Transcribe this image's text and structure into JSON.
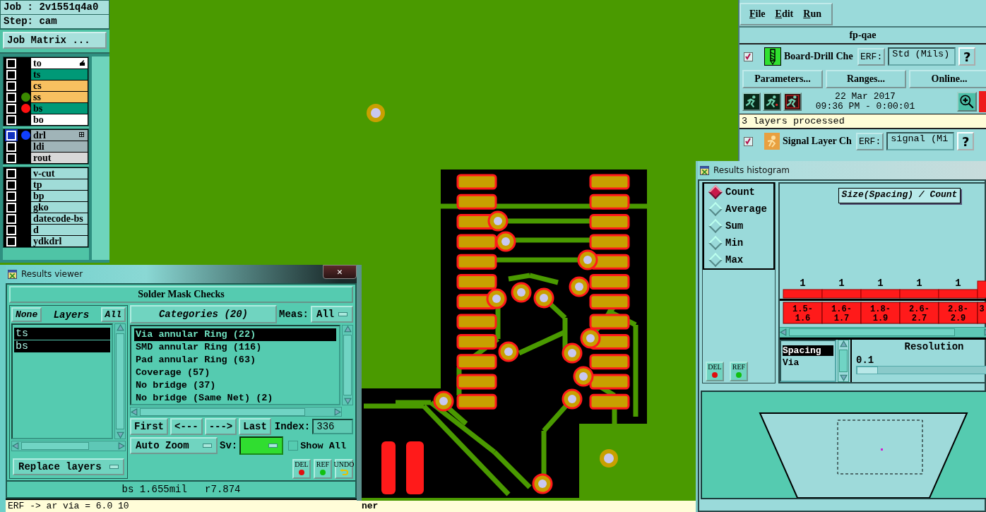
{
  "left_panel": {
    "job": "Job : 2v1551q4a0",
    "step": "Step: cam",
    "matrix_button": "Job Matrix ...",
    "layer_groups": [
      {
        "layers": [
          {
            "name": "to",
            "color": "#ffffff",
            "checked": false,
            "selected": false,
            "kind": "active"
          },
          {
            "name": "ts",
            "color": "#009977",
            "checked": false,
            "selected": false,
            "kind": "plain"
          },
          {
            "name": "cs",
            "color": "#f8c060",
            "checked": false,
            "selected": false,
            "kind": "plain"
          },
          {
            "name": "ss",
            "color": "#f8c060",
            "checked": false,
            "selected": false,
            "kind": "plain",
            "dot": {
              "color": "#3a8a00"
            }
          },
          {
            "name": "bs",
            "color": "#009977",
            "checked": false,
            "selected": false,
            "kind": "plain",
            "dot": {
              "color": "#ff1010"
            }
          },
          {
            "name": "bo",
            "color": "#ffffff",
            "checked": false,
            "selected": false,
            "kind": "plain"
          }
        ]
      },
      {
        "layers": [
          {
            "name": "drl",
            "color": "#a0b4b8",
            "checked": false,
            "selected": true,
            "kind": "expandable",
            "dot": {
              "color": "#1040ff"
            }
          },
          {
            "name": "ldi",
            "color": "#a0b4b8",
            "checked": false,
            "selected": false,
            "kind": "plain"
          },
          {
            "name": "rout",
            "color": "#d8d8d8",
            "checked": false,
            "selected": false,
            "kind": "plain"
          }
        ]
      },
      {
        "layers": [
          {
            "name": "v-cut",
            "color": "#a0dcd8",
            "checked": false,
            "selected": false,
            "kind": "plain"
          },
          {
            "name": "tp",
            "color": "#a0dcd8",
            "checked": false,
            "selected": false,
            "kind": "plain"
          },
          {
            "name": "bp",
            "color": "#a0dcd8",
            "checked": false,
            "selected": false,
            "kind": "plain"
          },
          {
            "name": "gko",
            "color": "#a0dcd8",
            "checked": false,
            "selected": false,
            "kind": "plain"
          },
          {
            "name": "datecode-bs",
            "color": "#a0dcd8",
            "checked": false,
            "selected": false,
            "kind": "plain"
          },
          {
            "name": "d",
            "color": "#a0dcd8",
            "checked": false,
            "selected": false,
            "kind": "plain"
          },
          {
            "name": "ydkdrl",
            "color": "#a0dcd8",
            "checked": false,
            "selected": false,
            "kind": "plain"
          }
        ]
      }
    ]
  },
  "results_viewer": {
    "title": "Results viewer",
    "close": "✕",
    "header": "Solder Mask Checks",
    "none_button": "None",
    "layers_label": "Layers",
    "all_button": "All",
    "layers": [
      {
        "name": "ts",
        "selected": true
      },
      {
        "name": "bs",
        "selected": true
      }
    ],
    "replace_dropdown": "Replace layers",
    "categories_button": "Categories (20)",
    "meas_label": "Meas:",
    "meas_value": "All",
    "categories": [
      {
        "label": "Via annular Ring (22)",
        "selected": true
      },
      {
        "label": "SMD annular Ring (116)",
        "selected": false
      },
      {
        "label": "Pad annular Ring (63)",
        "selected": false
      },
      {
        "label": "Coverage (57)",
        "selected": false
      },
      {
        "label": "No bridge (37)",
        "selected": false
      },
      {
        "label": "No bridge (Same Net) (2)",
        "selected": false
      }
    ],
    "nav_buttons": [
      "First",
      "<---",
      "--->",
      "Last"
    ],
    "index_label": "Index:",
    "index_value": "336",
    "zoom_dropdown": "Auto Zoom",
    "sv_label": "Sv:",
    "show_all": {
      "label": "Show All",
      "checked": false
    },
    "action_buttons": [
      {
        "label": "DEL",
        "kind": "delete"
      },
      {
        "label": "REF",
        "kind": "refresh"
      },
      {
        "label": "UNDO",
        "kind": "undo"
      }
    ],
    "status": "bs 1.655mil   r7.874",
    "message": "ERF -> ar via = 6.0 10"
  },
  "checks_window": {
    "menu": [
      "File",
      "Edit",
      "Run"
    ],
    "title": "fp-qae",
    "checks": [
      {
        "kind": "drill",
        "checked": true,
        "name": "Board-Drill Che",
        "erf_label": "ERF:",
        "erf_value": "Std (Mils)",
        "help": "?",
        "buttons": [
          "Parameters...",
          "Ranges...",
          "Online..."
        ],
        "date": "22 Mar 2017",
        "time": "09:36 PM - 0:00:01",
        "message": "3 layers processed"
      },
      {
        "kind": "signal",
        "checked": true,
        "name": "Signal Layer Ch",
        "erf_label": "ERF:",
        "erf_value": "signal (Mi",
        "help": "?"
      }
    ]
  },
  "histogram": {
    "title": "Results histogram",
    "modes": [
      {
        "label": "Count",
        "selected": true
      },
      {
        "label": "Average",
        "selected": false
      },
      {
        "label": "Sum",
        "selected": false
      },
      {
        "label": "Min",
        "selected": false
      },
      {
        "label": "Max",
        "selected": false
      }
    ],
    "action_buttons": [
      {
        "label": "DEL",
        "kind": "delete"
      },
      {
        "label": "REF",
        "kind": "refresh"
      }
    ],
    "chart_data": {
      "type": "bar",
      "title": "Size(Spacing) / Count",
      "categories": [
        "1.5-1.6",
        "1.6-1.7",
        "1.8-1.9",
        "2.6-2.7",
        "2.8-2.9",
        "3"
      ],
      "values": [
        1,
        1,
        1,
        1,
        1,
        2
      ],
      "value_labels": [
        "1",
        "1",
        "1",
        "1",
        "1",
        null
      ]
    },
    "measures": [
      {
        "label": "Spacing",
        "selected": true
      },
      {
        "label": "Via",
        "selected": false
      }
    ],
    "resolution_label": "Resolution",
    "resolution_value": "0.1",
    "resolution_slider": {
      "level": 0
    }
  },
  "bottom_message": "ner"
}
